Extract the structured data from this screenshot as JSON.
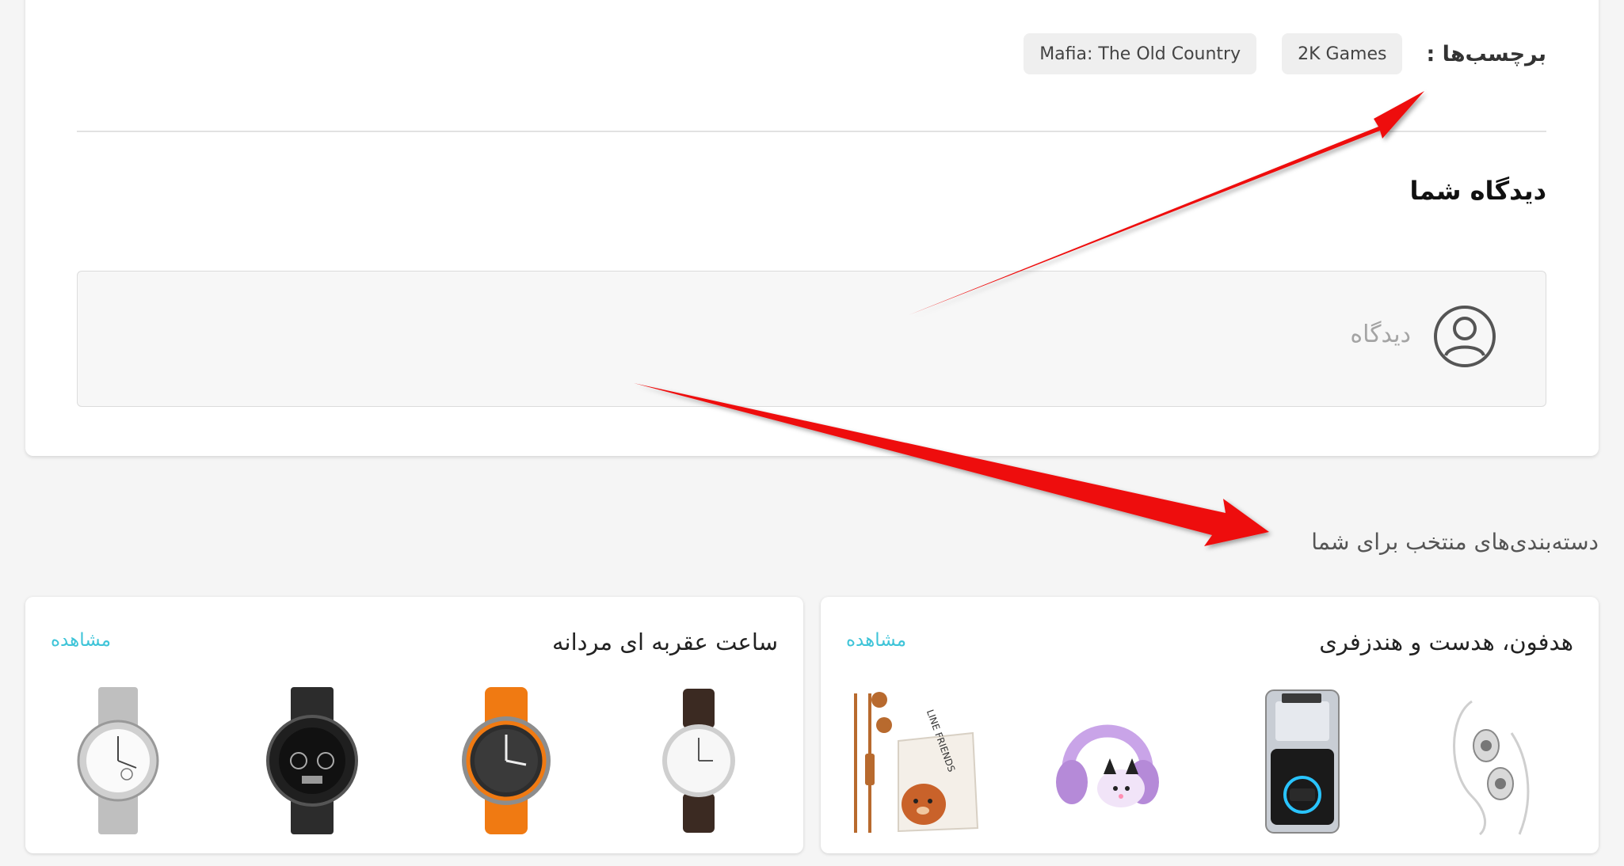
{
  "tags": {
    "label": "برچسب‌ها :",
    "items": [
      "2K Games",
      "Mafia: The Old Country"
    ]
  },
  "comments": {
    "title": "دیدگاه شما",
    "placeholder": "دیدگاه"
  },
  "picks": {
    "title": "دسته‌بندی‌های منتخب برای شما"
  },
  "categories": [
    {
      "title": "هدفون، هدست و هندزفری",
      "view_label": "مشاهده",
      "products": [
        "earphones-silver",
        "gaming-earbuds-case",
        "kids-headphones-purple",
        "earphones-pouch"
      ]
    },
    {
      "title": "ساعت عقربه ای مردانه",
      "view_label": "مشاهده",
      "products": [
        "watch-leather-white",
        "watch-orange-strap",
        "watch-black-steel",
        "watch-silver-steel"
      ]
    }
  ],
  "colors": {
    "accent": "#3ec4d8",
    "arrow": "#ee1111"
  }
}
